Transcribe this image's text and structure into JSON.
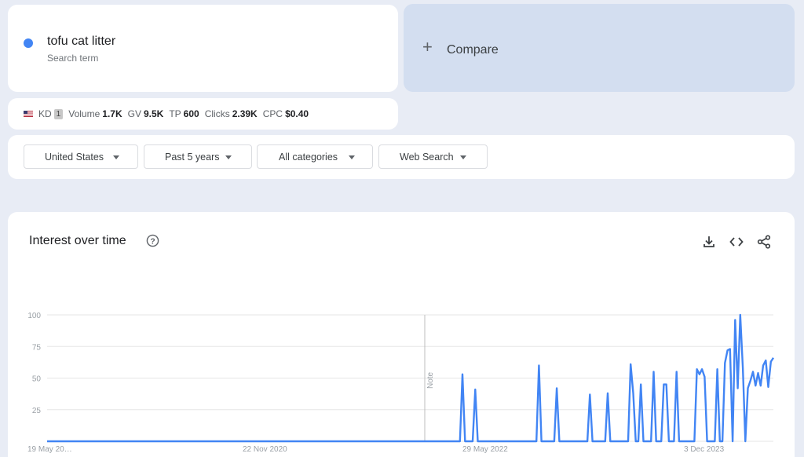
{
  "search_term": {
    "name": "tofu cat litter",
    "subtitle": "Search term",
    "dot_color": "#4285f4"
  },
  "compare": {
    "plus": "+",
    "label": "Compare"
  },
  "metrics": {
    "flag_icon": "us-flag-icon",
    "kd_label": "KD",
    "kd_value": "1",
    "volume_label": "Volume",
    "volume_value": "1.7K",
    "gv_label": "GV",
    "gv_value": "9.5K",
    "tp_label": "TP",
    "tp_value": "600",
    "clicks_label": "Clicks",
    "clicks_value": "2.39K",
    "cpc_label": "CPC",
    "cpc_value": "$0.40"
  },
  "filters": {
    "region": "United States",
    "time": "Past 5 years",
    "category": "All categories",
    "search_type": "Web Search"
  },
  "chart_section": {
    "title": "Interest over time",
    "help_icon": "help-circle-icon",
    "download_icon": "download-icon",
    "embed_icon": "code-icon",
    "share_icon": "share-icon"
  },
  "chart_data": {
    "type": "line",
    "series_color": "#4285f4",
    "y_ticks": [
      100,
      75,
      50,
      25
    ],
    "ylim": [
      0,
      100
    ],
    "x_tick_labels": [
      "19 May 20…",
      "22 Nov 2020",
      "29 May 2022",
      "3 Dec 2023"
    ],
    "note_label": "Note",
    "grid": true,
    "values": [
      0,
      0,
      0,
      0,
      0,
      0,
      0,
      0,
      0,
      0,
      0,
      0,
      0,
      0,
      0,
      0,
      0,
      0,
      0,
      0,
      0,
      0,
      0,
      0,
      0,
      0,
      0,
      0,
      0,
      0,
      0,
      0,
      0,
      0,
      0,
      0,
      0,
      0,
      0,
      0,
      0,
      0,
      0,
      0,
      0,
      0,
      0,
      0,
      0,
      0,
      0,
      0,
      0,
      0,
      0,
      0,
      0,
      0,
      0,
      0,
      0,
      0,
      0,
      0,
      0,
      0,
      0,
      0,
      0,
      0,
      0,
      0,
      0,
      0,
      0,
      0,
      0,
      0,
      0,
      0,
      0,
      0,
      0,
      0,
      0,
      0,
      0,
      0,
      0,
      0,
      0,
      0,
      0,
      0,
      0,
      0,
      0,
      0,
      0,
      0,
      0,
      0,
      0,
      0,
      0,
      0,
      0,
      0,
      0,
      0,
      0,
      0,
      0,
      0,
      0,
      0,
      0,
      0,
      0,
      0,
      0,
      0,
      0,
      0,
      0,
      0,
      0,
      0,
      0,
      0,
      0,
      0,
      0,
      0,
      0,
      0,
      0,
      0,
      0,
      0,
      0,
      0,
      0,
      0,
      0,
      0,
      0,
      0,
      0,
      0,
      0,
      0,
      0,
      0,
      0,
      0,
      0,
      0,
      0,
      0,
      0,
      0,
      0,
      53,
      0,
      0,
      0,
      0,
      41,
      0,
      0,
      0,
      0,
      0,
      0,
      0,
      0,
      0,
      0,
      0,
      0,
      0,
      0,
      0,
      0,
      0,
      0,
      0,
      0,
      0,
      0,
      0,
      0,
      60,
      0,
      0,
      0,
      0,
      0,
      0,
      42,
      0,
      0,
      0,
      0,
      0,
      0,
      0,
      0,
      0,
      0,
      0,
      0,
      37,
      0,
      0,
      0,
      0,
      0,
      0,
      38,
      0,
      0,
      0,
      0,
      0,
      0,
      0,
      0,
      61,
      38,
      0,
      0,
      45,
      0,
      0,
      0,
      0,
      55,
      0,
      0,
      0,
      45,
      45,
      0,
      0,
      0,
      55,
      0,
      0,
      0,
      0,
      0,
      0,
      0,
      57,
      53,
      57,
      51,
      0,
      0,
      0,
      0,
      57,
      0,
      0,
      62,
      72,
      73,
      0,
      96,
      42,
      100,
      58,
      0,
      42,
      48,
      55,
      44,
      54,
      44,
      60,
      64,
      43,
      63,
      66
    ]
  }
}
